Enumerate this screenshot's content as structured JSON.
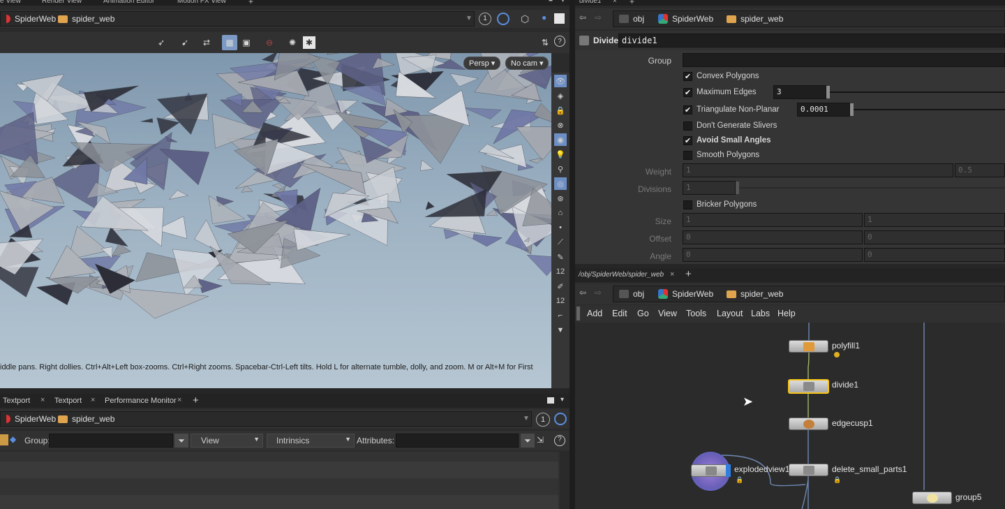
{
  "top_tabs": {
    "items": [
      "e View",
      "Render View",
      "Animation Editor",
      "Motion FX View"
    ],
    "right_tab": "divide1"
  },
  "viewport_path": {
    "items": [
      "SpiderWeb",
      "spider_web"
    ],
    "badge": "1"
  },
  "viewport": {
    "persp_label": "Persp",
    "cam_label": "No cam",
    "status_text": "iddle pans. Right dollies. Ctrl+Alt+Left box-zooms. Ctrl+Right zooms. Spacebar-Ctrl-Left tilts. Hold L for alternate tumble, dolly, and zoom. M or Alt+M for First",
    "right_shelf_numbers": [
      "12",
      "12"
    ]
  },
  "param_path": {
    "items": [
      "obj",
      "SpiderWeb",
      "spider_web"
    ]
  },
  "param_header": {
    "type": "Divide",
    "name": "divide1"
  },
  "params": {
    "group_label": "Group",
    "convex_polygons": "Convex Polygons",
    "maximum_edges": "Maximum Edges",
    "maximum_edges_value": "3",
    "triangulate": "Triangulate Non-Planar",
    "triangulate_value": "0.0001",
    "dont_slivers": "Don't Generate Slivers",
    "avoid_small": "Avoid Small Angles",
    "smooth_polygons": "Smooth Polygons",
    "weight_label": "Weight",
    "weight_a": "1",
    "weight_b": "0.5",
    "divisions_label": "Divisions",
    "divisions_value": "1",
    "bricker": "Bricker Polygons",
    "size_label": "Size",
    "size_a": "1",
    "size_b": "1",
    "offset_label": "Offset",
    "offset_a": "0",
    "offset_b": "0",
    "angle_label": "Angle",
    "angle_a": "0",
    "angle_b": "0"
  },
  "network_tab": "/obj/SpiderWeb/spider_web",
  "network_path": {
    "items": [
      "obj",
      "SpiderWeb",
      "spider_web"
    ]
  },
  "network_menu": [
    "Add",
    "Edit",
    "Go",
    "View",
    "Tools",
    "Layout",
    "Labs",
    "Help"
  ],
  "nodes": {
    "polyfill": "polyfill1",
    "divide": "divide1",
    "edgecusp": "edgecusp1",
    "explodedview": "explodedview1",
    "delete_small": "delete_small_parts1",
    "group5": "group5"
  },
  "bottom_tabs": [
    "Textport",
    "Textport",
    "Performance Monitor"
  ],
  "spreadsheet_path": {
    "items": [
      "SpiderWeb",
      "spider_web"
    ],
    "badge": "1"
  },
  "spreadsheet_toolbar": {
    "group_label": "Group:",
    "view_label": "View",
    "intrinsics_label": "Intrinsics",
    "attributes_label": "Attributes:"
  },
  "colors": {
    "selected_node": "#f5c518",
    "accent_blue": "#4a7fd0",
    "wire": "#6f89b3"
  }
}
